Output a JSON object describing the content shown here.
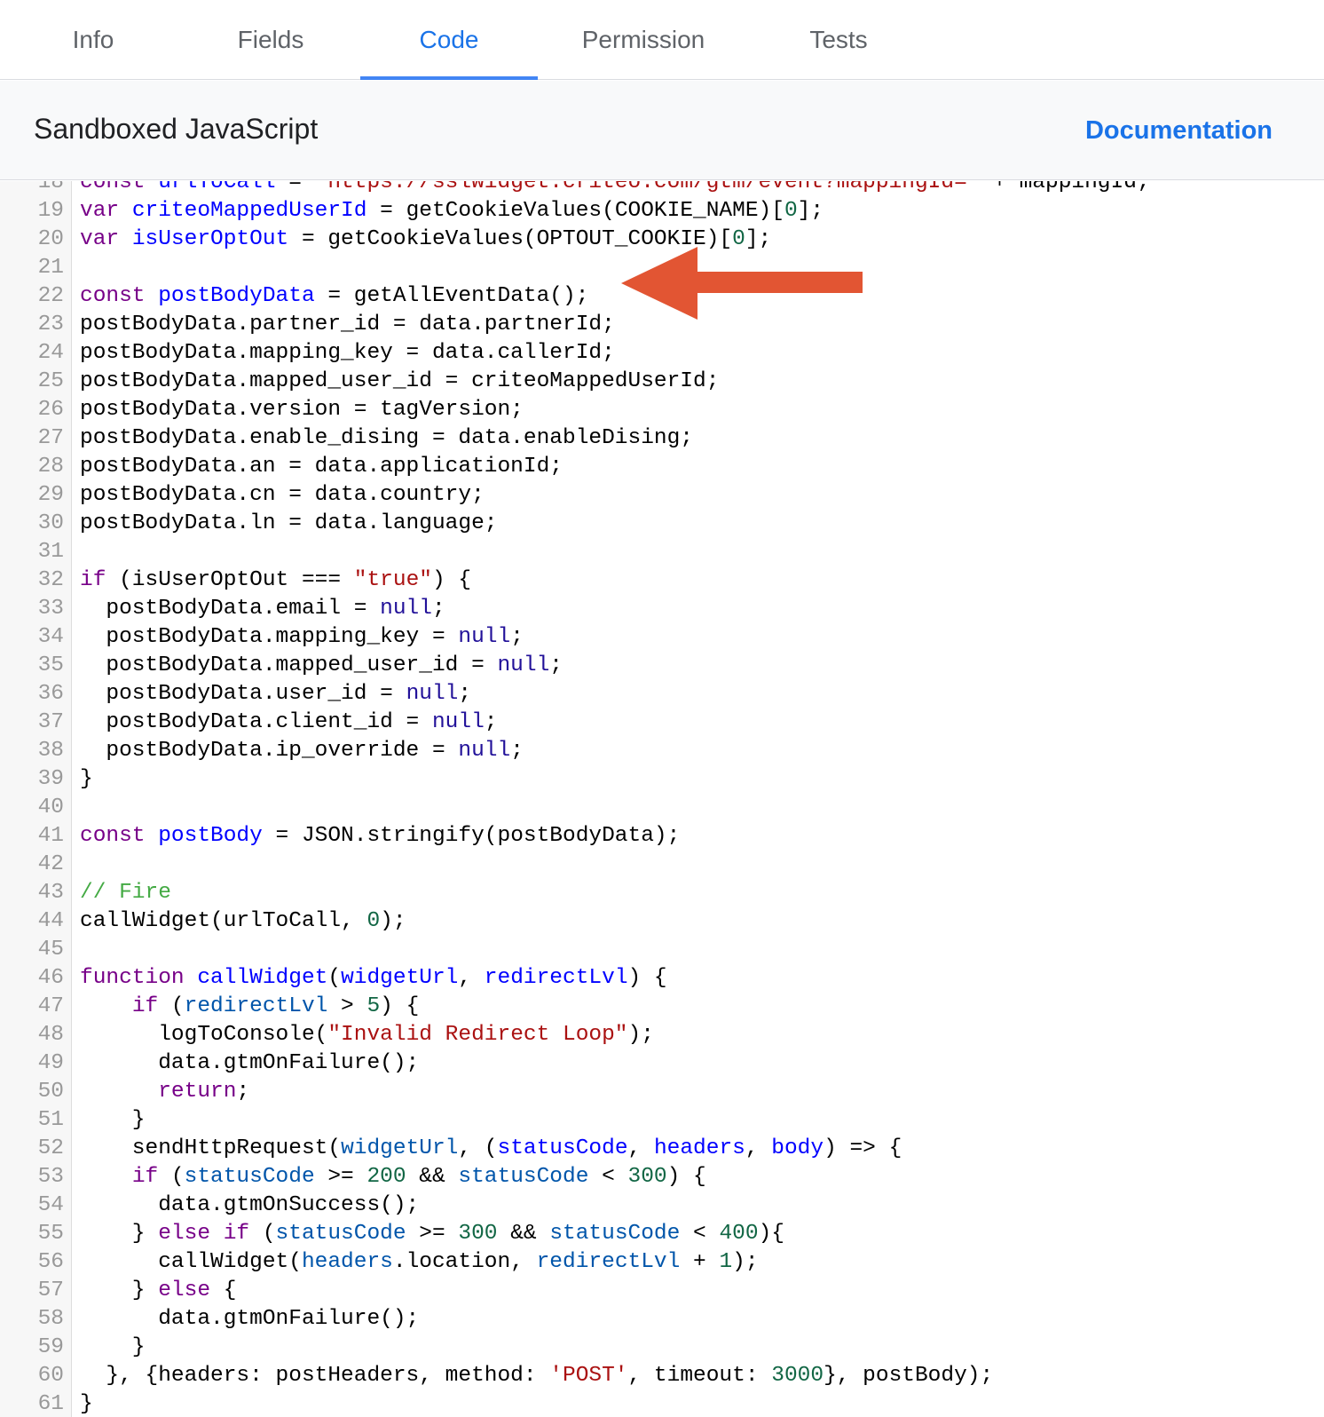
{
  "tabs": [
    {
      "label": "Info",
      "active": false
    },
    {
      "label": "Fields",
      "active": false
    },
    {
      "label": "Code",
      "active": true
    },
    {
      "label": "Permission",
      "active": false
    },
    {
      "label": "Tests",
      "active": false
    }
  ],
  "section": {
    "title": "Sandboxed JavaScript",
    "doc_link": "Documentation"
  },
  "colors": {
    "keyword": "#770088",
    "def": "#0000ff",
    "variable2": "#0055aa",
    "atom": "#221199",
    "number": "#116644",
    "string": "#aa1111",
    "comment": "#44aa44",
    "arrow": "#e25533"
  },
  "annotation": {
    "icon": "arrow-left-icon",
    "color": "#e25533"
  },
  "code_lines": [
    {
      "n": "18",
      "t": [
        [
          "k",
          "const "
        ],
        [
          "d",
          "urlToCall"
        ],
        [
          "p",
          " = "
        ],
        [
          "s",
          "'https://sslwidget.criteo.com/gtm/event?mappingId='"
        ],
        [
          "p",
          " + mappingId;"
        ]
      ]
    },
    {
      "n": "19",
      "t": [
        [
          "k",
          "var "
        ],
        [
          "d",
          "criteoMappedUserId"
        ],
        [
          "p",
          " = getCookieValues(COOKIE_NAME)["
        ],
        [
          "n",
          "0"
        ],
        [
          "p",
          "];"
        ]
      ]
    },
    {
      "n": "20",
      "t": [
        [
          "k",
          "var "
        ],
        [
          "d",
          "isUserOptOut"
        ],
        [
          "p",
          " = getCookieValues(OPTOUT_COOKIE)["
        ],
        [
          "n",
          "0"
        ],
        [
          "p",
          "];"
        ]
      ]
    },
    {
      "n": "21",
      "t": [
        [
          "p",
          ""
        ]
      ]
    },
    {
      "n": "22",
      "t": [
        [
          "k",
          "const "
        ],
        [
          "d",
          "postBodyData"
        ],
        [
          "p",
          " = getAllEventData();"
        ]
      ]
    },
    {
      "n": "23",
      "t": [
        [
          "p",
          "postBodyData.partner_id = data.partnerId;"
        ]
      ]
    },
    {
      "n": "24",
      "t": [
        [
          "p",
          "postBodyData.mapping_key = data.callerId;"
        ]
      ]
    },
    {
      "n": "25",
      "t": [
        [
          "p",
          "postBodyData.mapped_user_id = criteoMappedUserId;"
        ]
      ]
    },
    {
      "n": "26",
      "t": [
        [
          "p",
          "postBodyData.version = tagVersion;"
        ]
      ]
    },
    {
      "n": "27",
      "t": [
        [
          "p",
          "postBodyData.enable_dising = data.enableDising;"
        ]
      ]
    },
    {
      "n": "28",
      "t": [
        [
          "p",
          "postBodyData.an = data.applicationId;"
        ]
      ]
    },
    {
      "n": "29",
      "t": [
        [
          "p",
          "postBodyData.cn = data.country;"
        ]
      ]
    },
    {
      "n": "30",
      "t": [
        [
          "p",
          "postBodyData.ln = data.language;"
        ]
      ]
    },
    {
      "n": "31",
      "t": [
        [
          "p",
          ""
        ]
      ]
    },
    {
      "n": "32",
      "t": [
        [
          "k",
          "if"
        ],
        [
          "p",
          " (isUserOptOut === "
        ],
        [
          "s",
          "\"true\""
        ],
        [
          "p",
          ") {"
        ]
      ]
    },
    {
      "n": "33",
      "t": [
        [
          "p",
          "  postBodyData.email = "
        ],
        [
          "a",
          "null"
        ],
        [
          "p",
          ";"
        ]
      ]
    },
    {
      "n": "34",
      "t": [
        [
          "p",
          "  postBodyData.mapping_key = "
        ],
        [
          "a",
          "null"
        ],
        [
          "p",
          ";"
        ]
      ]
    },
    {
      "n": "35",
      "t": [
        [
          "p",
          "  postBodyData.mapped_user_id = "
        ],
        [
          "a",
          "null"
        ],
        [
          "p",
          ";"
        ]
      ]
    },
    {
      "n": "36",
      "t": [
        [
          "p",
          "  postBodyData.user_id = "
        ],
        [
          "a",
          "null"
        ],
        [
          "p",
          ";"
        ]
      ]
    },
    {
      "n": "37",
      "t": [
        [
          "p",
          "  postBodyData.client_id = "
        ],
        [
          "a",
          "null"
        ],
        [
          "p",
          ";"
        ]
      ]
    },
    {
      "n": "38",
      "t": [
        [
          "p",
          "  postBodyData.ip_override = "
        ],
        [
          "a",
          "null"
        ],
        [
          "p",
          ";"
        ]
      ]
    },
    {
      "n": "39",
      "t": [
        [
          "p",
          "}"
        ]
      ]
    },
    {
      "n": "40",
      "t": [
        [
          "p",
          ""
        ]
      ]
    },
    {
      "n": "41",
      "t": [
        [
          "k",
          "const "
        ],
        [
          "d",
          "postBody"
        ],
        [
          "p",
          " = JSON.stringify(postBodyData);"
        ]
      ]
    },
    {
      "n": "42",
      "t": [
        [
          "p",
          ""
        ]
      ]
    },
    {
      "n": "43",
      "t": [
        [
          "c",
          "// Fire"
        ]
      ]
    },
    {
      "n": "44",
      "t": [
        [
          "p",
          "callWidget(urlToCall, "
        ],
        [
          "n",
          "0"
        ],
        [
          "p",
          ");"
        ]
      ]
    },
    {
      "n": "45",
      "t": [
        [
          "p",
          ""
        ]
      ]
    },
    {
      "n": "46",
      "t": [
        [
          "k",
          "function "
        ],
        [
          "d",
          "callWidget"
        ],
        [
          "p",
          "("
        ],
        [
          "d",
          "widgetUrl"
        ],
        [
          "p",
          ", "
        ],
        [
          "d",
          "redirectLvl"
        ],
        [
          "p",
          ") {"
        ]
      ]
    },
    {
      "n": "47",
      "t": [
        [
          "p",
          "    "
        ],
        [
          "k",
          "if"
        ],
        [
          "p",
          " ("
        ],
        [
          "v",
          "redirectLvl"
        ],
        [
          "p",
          " > "
        ],
        [
          "n",
          "5"
        ],
        [
          "p",
          ") {"
        ]
      ]
    },
    {
      "n": "48",
      "t": [
        [
          "p",
          "      logToConsole("
        ],
        [
          "s",
          "\"Invalid Redirect Loop\""
        ],
        [
          "p",
          ");"
        ]
      ]
    },
    {
      "n": "49",
      "t": [
        [
          "p",
          "      data.gtmOnFailure();"
        ]
      ]
    },
    {
      "n": "50",
      "t": [
        [
          "p",
          "      "
        ],
        [
          "k",
          "return"
        ],
        [
          "p",
          ";"
        ]
      ]
    },
    {
      "n": "51",
      "t": [
        [
          "p",
          "    }"
        ]
      ]
    },
    {
      "n": "52",
      "t": [
        [
          "p",
          "    sendHttpRequest("
        ],
        [
          "v",
          "widgetUrl"
        ],
        [
          "p",
          ", ("
        ],
        [
          "d",
          "statusCode"
        ],
        [
          "p",
          ", "
        ],
        [
          "d",
          "headers"
        ],
        [
          "p",
          ", "
        ],
        [
          "d",
          "body"
        ],
        [
          "p",
          ") => {"
        ]
      ]
    },
    {
      "n": "53",
      "t": [
        [
          "p",
          "    "
        ],
        [
          "k",
          "if"
        ],
        [
          "p",
          " ("
        ],
        [
          "v",
          "statusCode"
        ],
        [
          "p",
          " >= "
        ],
        [
          "n",
          "200"
        ],
        [
          "p",
          " && "
        ],
        [
          "v",
          "statusCode"
        ],
        [
          "p",
          " < "
        ],
        [
          "n",
          "300"
        ],
        [
          "p",
          ") {"
        ]
      ]
    },
    {
      "n": "54",
      "t": [
        [
          "p",
          "      data.gtmOnSuccess();"
        ]
      ]
    },
    {
      "n": "55",
      "t": [
        [
          "p",
          "    } "
        ],
        [
          "k",
          "else if"
        ],
        [
          "p",
          " ("
        ],
        [
          "v",
          "statusCode"
        ],
        [
          "p",
          " >= "
        ],
        [
          "n",
          "300"
        ],
        [
          "p",
          " && "
        ],
        [
          "v",
          "statusCode"
        ],
        [
          "p",
          " < "
        ],
        [
          "n",
          "400"
        ],
        [
          "p",
          "){"
        ]
      ]
    },
    {
      "n": "56",
      "t": [
        [
          "p",
          "      callWidget("
        ],
        [
          "v",
          "headers"
        ],
        [
          "p",
          ".location, "
        ],
        [
          "v",
          "redirectLvl"
        ],
        [
          "p",
          " + "
        ],
        [
          "n",
          "1"
        ],
        [
          "p",
          ");"
        ]
      ]
    },
    {
      "n": "57",
      "t": [
        [
          "p",
          "    } "
        ],
        [
          "k",
          "else"
        ],
        [
          "p",
          " {"
        ]
      ]
    },
    {
      "n": "58",
      "t": [
        [
          "p",
          "      data.gtmOnFailure();"
        ]
      ]
    },
    {
      "n": "59",
      "t": [
        [
          "p",
          "    }"
        ]
      ]
    },
    {
      "n": "60",
      "t": [
        [
          "p",
          "  }, {headers: postHeaders, method: "
        ],
        [
          "s",
          "'POST'"
        ],
        [
          "p",
          ", timeout: "
        ],
        [
          "n",
          "3000"
        ],
        [
          "p",
          "}, postBody);"
        ]
      ]
    },
    {
      "n": "61",
      "t": [
        [
          "p",
          "}"
        ]
      ]
    }
  ]
}
